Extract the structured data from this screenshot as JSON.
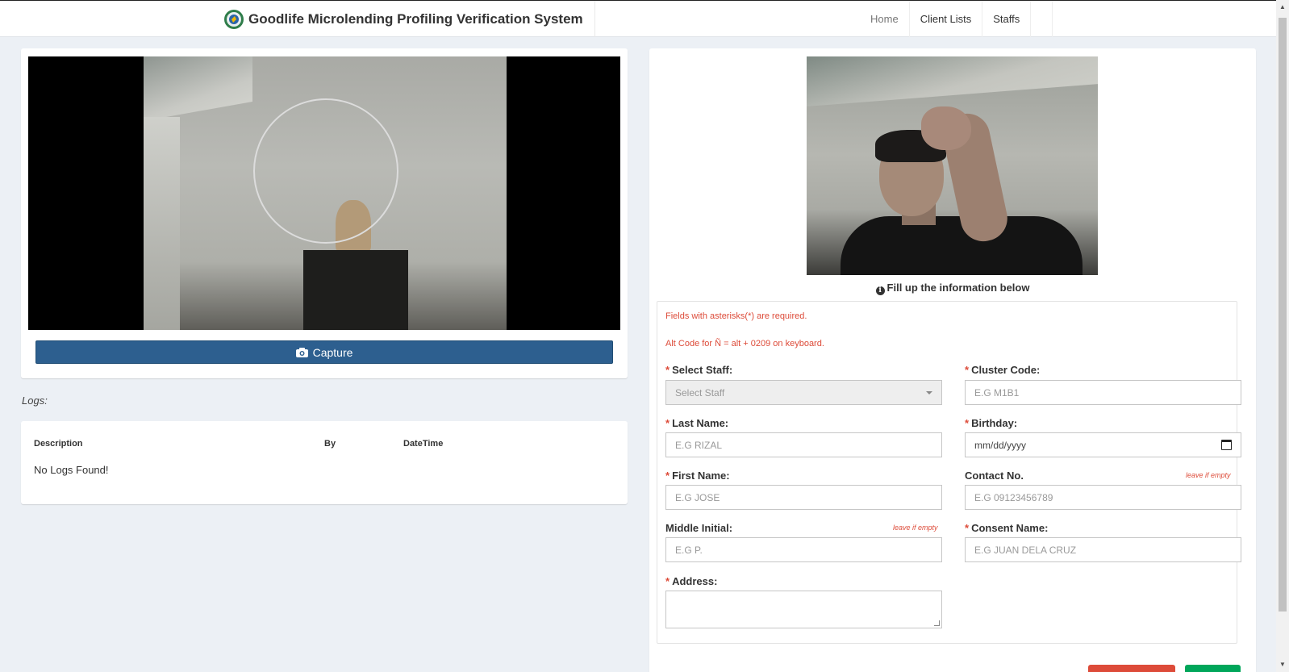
{
  "header": {
    "title": "Goodlife Microlending Profiling Verification System",
    "nav": [
      {
        "label": "Home"
      },
      {
        "label": "Client Lists"
      },
      {
        "label": "Staffs"
      }
    ]
  },
  "camera": {
    "capture_label": "Capture"
  },
  "logs": {
    "section_label": "Logs:",
    "columns": [
      "Description",
      "By",
      "DateTime"
    ],
    "empty_text": "No Logs Found!"
  },
  "form": {
    "heading": "Fill up the information below",
    "notes": {
      "required": "Fields with asterisks(*) are required.",
      "alt_code": "Alt Code for Ñ = alt + 0209 on keyboard."
    },
    "fields": {
      "staff": {
        "label": "Select Staff:",
        "value": "Select Staff"
      },
      "cluster_code": {
        "label": "Cluster Code:",
        "placeholder": "E.G M1B1"
      },
      "last_name": {
        "label": "Last Name:",
        "placeholder": "E.G RIZAL"
      },
      "birthday": {
        "label": "Birthday:",
        "value": "mm/dd/yyyy"
      },
      "first_name": {
        "label": "First Name:",
        "placeholder": "E.G JOSE"
      },
      "contact_no": {
        "label": "Contact No.",
        "placeholder": "E.G 09123456789",
        "hint": "leave if empty"
      },
      "middle_initial": {
        "label": "Middle Initial:",
        "placeholder": "E.G P.",
        "hint": "leave if empty"
      },
      "consent_name": {
        "label": "Consent Name:",
        "placeholder": "E.G JUAN DELA CRUZ"
      },
      "address": {
        "label": "Address:"
      }
    },
    "required_mark": "*"
  },
  "colors": {
    "primary": "#2d5f8f",
    "danger": "#dd4b39",
    "success": "#00a65a",
    "background": "#ecf0f5"
  }
}
